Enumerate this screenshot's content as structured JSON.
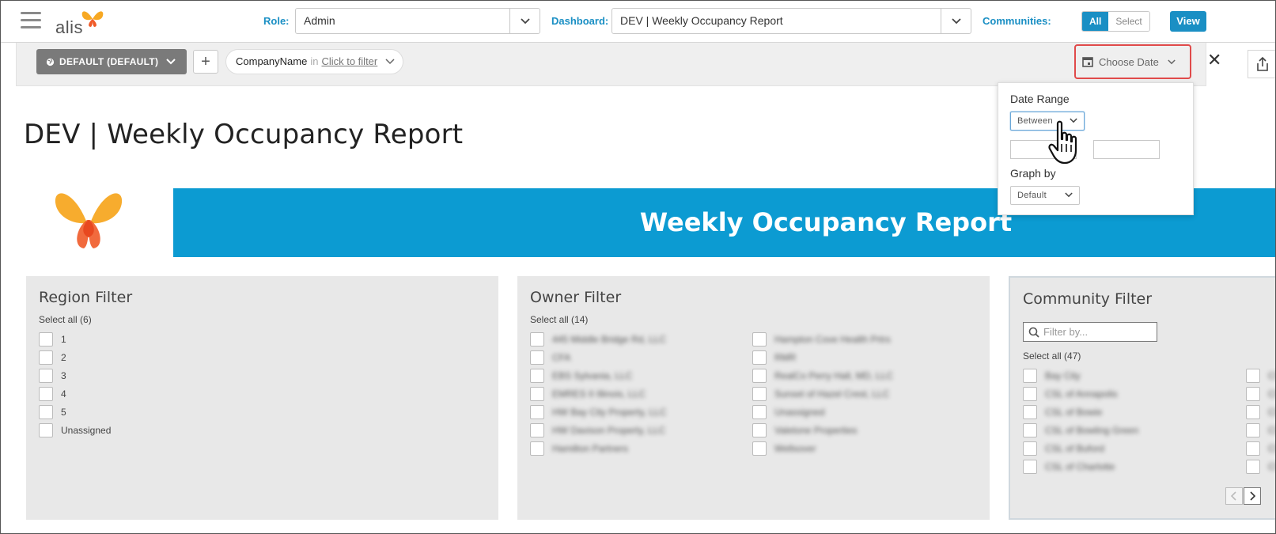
{
  "header": {
    "logo_text": "alis",
    "role_label": "Role:",
    "role_value": "Admin",
    "dashboard_label": "Dashboard:",
    "dashboard_value": "DEV | Weekly Occupancy Report",
    "communities_label": "Communities:",
    "communities_all": "All",
    "communities_select": "Select",
    "view_button": "View"
  },
  "filterbar": {
    "default_button": "DEFAULT (DEFAULT)",
    "add_button": "+",
    "pill_field": "CompanyName",
    "pill_in": "in",
    "pill_link": "Click to filter",
    "choose_date": "Choose Date",
    "close_symbol": "✕"
  },
  "date_popover": {
    "date_range_label": "Date Range",
    "range_mode": "Between",
    "start_value": "",
    "end_value": "",
    "graph_by_label": "Graph by",
    "graph_by_value": "Default"
  },
  "page": {
    "title": "DEV | Weekly Occupancy Report",
    "banner_title": "Weekly Occupancy Report"
  },
  "region_filter": {
    "title": "Region Filter",
    "select_all": "Select all (6)",
    "items": [
      "1",
      "2",
      "3",
      "4",
      "5",
      "Unassigned"
    ]
  },
  "owner_filter": {
    "title": "Owner Filter",
    "select_all": "Select all (14)",
    "col1": [
      "445 Middle Bridge Rd, LLC",
      "CFA",
      "EBS Sylvania, LLC",
      "EMRES II Illinois, LLC",
      "HW Bay City Property, LLC",
      "HW Davison Property, LLC",
      "Hamilton Partners"
    ],
    "col2": [
      "Hampton Cove Health Prtrs",
      "RMR",
      "RealCo Perry Hall, MD, LLC",
      "Sunset of Hazel Crest, LLC",
      "Unassigned",
      "Valetone Properties",
      "Wellsover"
    ]
  },
  "community_filter": {
    "title": "Community Filter",
    "search_placeholder": "Filter by...",
    "select_all": "Select all (47)",
    "col1": [
      "Bay City",
      "CSL of Annapolis",
      "CSL of Bowie",
      "CSL of Bowling Green",
      "CSL of Buford",
      "CSL of Charlotte"
    ],
    "col2": [
      "CS",
      "CS",
      "CS",
      "CS",
      "CS",
      "CS"
    ]
  },
  "colors": {
    "accent": "#1a8fc4",
    "banner": "#0c9bd2",
    "highlight": "#e04a4a",
    "panel_bg": "#e8e8e8"
  }
}
